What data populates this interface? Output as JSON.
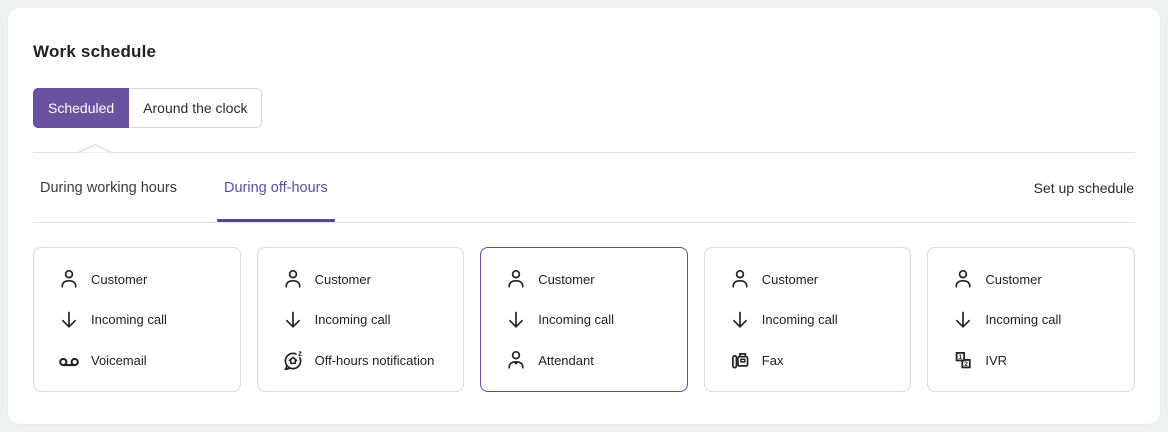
{
  "colors": {
    "accent": "#5e4b9e",
    "accent-dark": "#56459a",
    "button-purple": "#6952a0",
    "page-bg": "#f0f2f1",
    "border": "#e0e0e0",
    "card-border": "#dcdcdc",
    "text": "#262626"
  },
  "header": {
    "title": "Work schedule"
  },
  "toggle": {
    "scheduled_label": "Scheduled",
    "around_label": "Around the clock",
    "selected": "Scheduled"
  },
  "tabs": {
    "working_hours": "During working hours",
    "off_hours": "During off-hours",
    "active": "During off-hours",
    "setup_link": "Set up schedule"
  },
  "cards": [
    {
      "selected": false,
      "rows": [
        {
          "icon": "customer-icon",
          "label": "Customer"
        },
        {
          "icon": "incoming-call-icon",
          "label": "Incoming call"
        },
        {
          "icon": "voicemail-icon",
          "label": "Voicemail"
        }
      ]
    },
    {
      "selected": false,
      "rows": [
        {
          "icon": "customer-icon",
          "label": "Customer"
        },
        {
          "icon": "incoming-call-icon",
          "label": "Incoming call"
        },
        {
          "icon": "off-hours-notification-icon",
          "label": "Off-hours notification"
        }
      ]
    },
    {
      "selected": true,
      "rows": [
        {
          "icon": "customer-icon",
          "label": "Customer"
        },
        {
          "icon": "incoming-call-icon",
          "label": "Incoming call"
        },
        {
          "icon": "attendant-icon",
          "label": "Attendant"
        }
      ]
    },
    {
      "selected": false,
      "rows": [
        {
          "icon": "customer-icon",
          "label": "Customer"
        },
        {
          "icon": "incoming-call-icon",
          "label": "Incoming call"
        },
        {
          "icon": "fax-icon",
          "label": "Fax"
        }
      ]
    },
    {
      "selected": false,
      "rows": [
        {
          "icon": "customer-icon",
          "label": "Customer"
        },
        {
          "icon": "incoming-call-icon",
          "label": "Incoming call"
        },
        {
          "icon": "ivr-icon",
          "label": "IVR"
        }
      ]
    }
  ]
}
